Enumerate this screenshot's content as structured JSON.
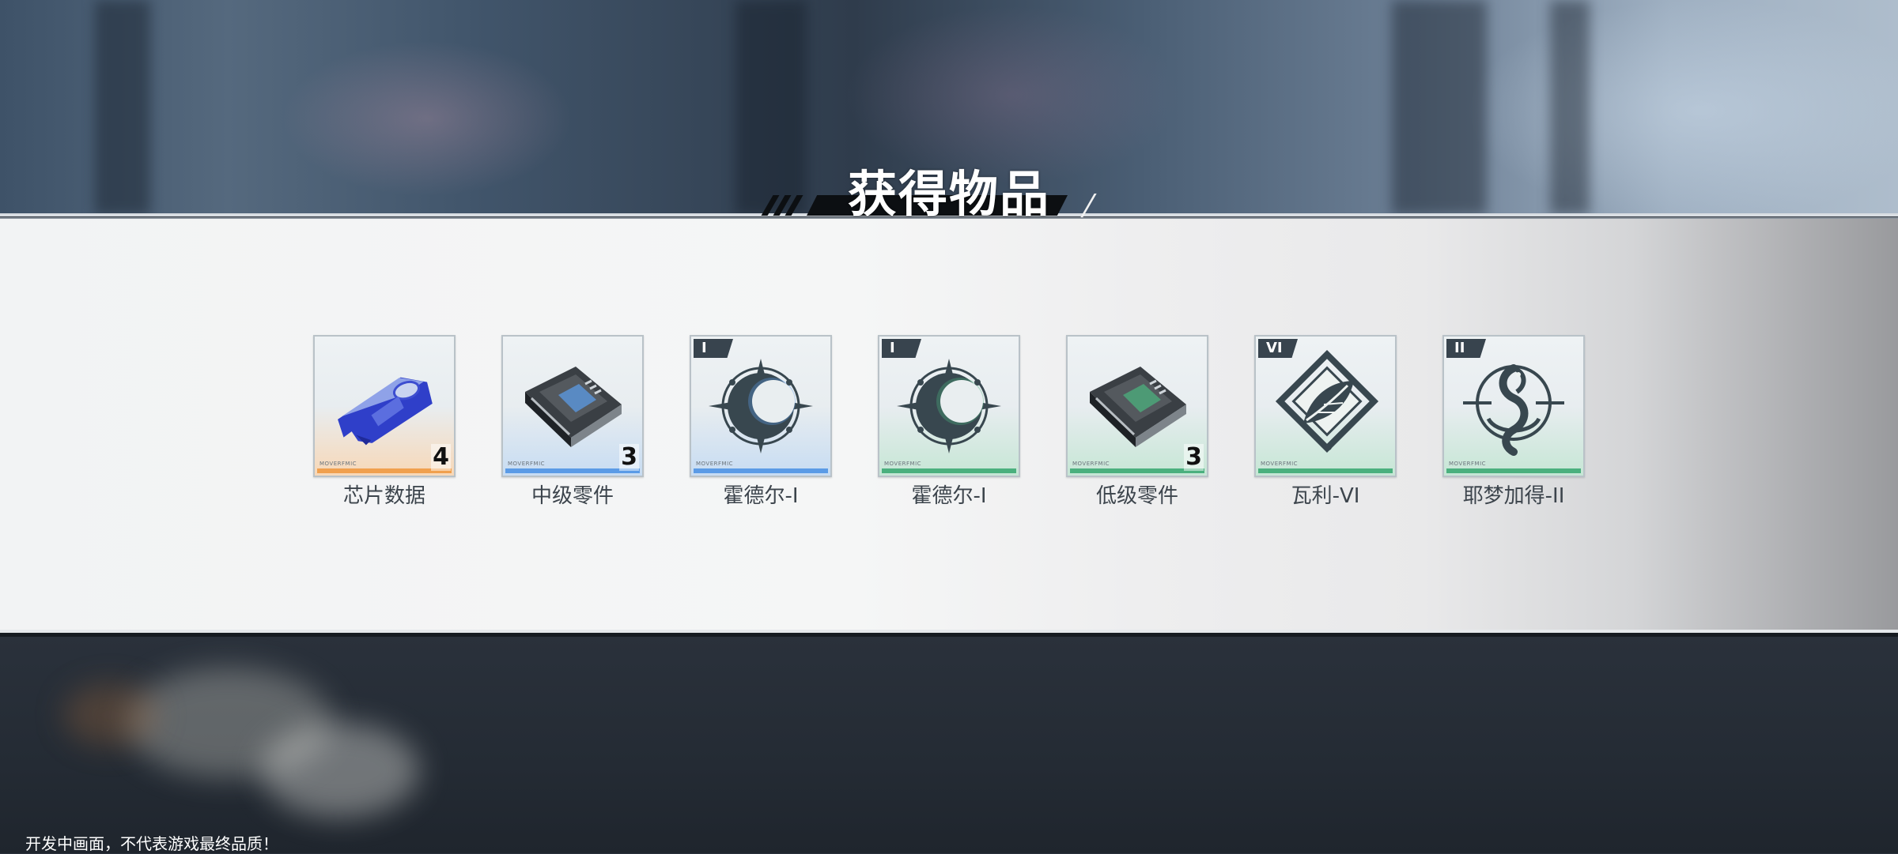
{
  "dialog": {
    "title": "获得物品"
  },
  "items": [
    {
      "name": "芯片数据",
      "count": "4",
      "tier": "",
      "icon": "chip-data-icon",
      "quality_color": "#f0a04e",
      "tint": "#f7d8b8"
    },
    {
      "name": "中级零件",
      "count": "3",
      "tier": "",
      "icon": "circuit-part-icon",
      "quality_color": "#5b9be6",
      "tint": "#c7dcf2"
    },
    {
      "name": "霍德尔-I",
      "count": "",
      "tier": "I",
      "icon": "compass-emblem-icon",
      "quality_color": "#5b9be6",
      "tint": "#c7dcf2"
    },
    {
      "name": "霍德尔-I",
      "count": "",
      "tier": "I",
      "icon": "compass-emblem-icon",
      "quality_color": "#4bb07e",
      "tint": "#c6e6d5"
    },
    {
      "name": "低级零件",
      "count": "3",
      "tier": "",
      "icon": "circuit-part-icon",
      "quality_color": "#4bb07e",
      "tint": "#c6e6d5"
    },
    {
      "name": "瓦利-VI",
      "count": "",
      "tier": "VI",
      "icon": "leaf-diamond-emblem-icon",
      "quality_color": "#4bb07e",
      "tint": "#c6e6d5"
    },
    {
      "name": "耶梦加得-II",
      "count": "",
      "tier": "II",
      "icon": "serpent-emblem-icon",
      "quality_color": "#4bb07e",
      "tint": "#c6e6d5"
    }
  ],
  "card_brand": "MOVERFMIC",
  "footer": {
    "disclaimer": "开发中画面，不代表游戏最终品质！"
  }
}
